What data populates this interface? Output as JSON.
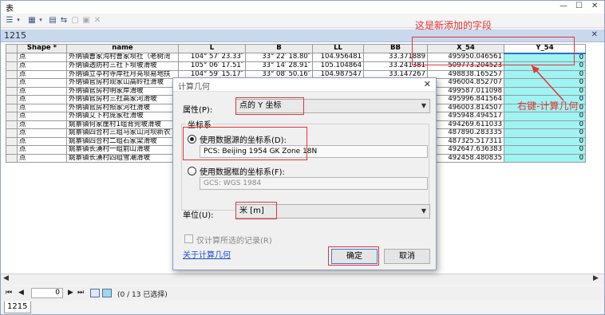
{
  "window": {
    "title": "表",
    "controls": {
      "minimize": "—",
      "restore": "☐",
      "close": "✕"
    }
  },
  "toolbar": {
    "icons": [
      "table-options-icon",
      "related-tables-icon",
      "select-by-attributes-icon",
      "switch-selection-icon",
      "clear-selection-icon",
      "zoom-to-selected-icon",
      "delete-selected-icon"
    ]
  },
  "tab": {
    "label": "1215",
    "close": "✕"
  },
  "table": {
    "headers": [
      "",
      "Shape *",
      "name",
      "L",
      "B",
      "LL",
      "BB",
      "X_54",
      "Y_54"
    ],
    "rows": [
      [
        "",
        "点",
        "外纳镇曹家沟村曹家坝社（老树湾",
        "104° 57′ 23.33″",
        "33° 22′ 18.80″",
        "104.956481",
        "33.371889",
        "495950.046561",
        "0"
      ],
      [
        "",
        "点",
        "外纳镇透防村三社下坝坡滑坡",
        "105° 06′ 17.51″",
        "33° 14′ 28.91″",
        "105.104864",
        "33.241381",
        "509773.204523",
        "0"
      ],
      [
        "",
        "点",
        "外纳镇立亭村寺岸社月亮坝易地扶",
        "104° 59′ 15.17″",
        "33° 08′ 50.16″",
        "104.987547",
        "33.147267",
        "498838.165257",
        "0"
      ],
      [
        "",
        "点",
        "外纳镇官房村现家山高岭社滑坡",
        "",
        "",
        "",
        "",
        "496004.852707",
        "0"
      ],
      [
        "",
        "点",
        "外纳镇官房村明家岸滑坡",
        "",
        "",
        "",
        "",
        "499587.011098",
        "0"
      ],
      [
        "",
        "点",
        "外纳镇官房村三社高家河滑坡",
        "",
        "",
        "",
        "",
        "495996.841564",
        "0"
      ],
      [
        "",
        "点",
        "外纳镇官房村照家河社滑坡",
        "",
        "",
        "",
        "",
        "496003.814507",
        "0"
      ],
      [
        "",
        "点",
        "外纳镇艾下村庞家社滑坡",
        "",
        "",
        "",
        "",
        "495948.494517",
        "0"
      ],
      [
        "",
        "点",
        "姚寨镇何家崖村1组背兜坡滑坡",
        "",
        "",
        "",
        "",
        "494269.611033",
        "0"
      ],
      [
        "",
        "点",
        "姚寨镇四合村三组马家山河坝新农",
        "",
        "",
        "",
        "",
        "487890.283335",
        "0"
      ],
      [
        "",
        "点",
        "姚寨镇四合村二组石家梁滑坡",
        "",
        "",
        "",
        "",
        "487325.517311",
        "0"
      ],
      [
        "",
        "点",
        "姚寨镇长湧村一组前山滑坡",
        "",
        "",
        "",
        "",
        "492647.636383",
        "0"
      ],
      [
        "",
        "点",
        "姚寨镇长湧村四组雪潮滑坡",
        "",
        "",
        "",
        "",
        "492458.480835",
        "0"
      ]
    ]
  },
  "navigation": {
    "first": "⏮",
    "prev": "◀",
    "current": "0",
    "next": "▶",
    "last": "⏭",
    "status": "(0 / 13 已选择)"
  },
  "status_tab": "1215",
  "annotations": {
    "new_field": "这是新添加的字段",
    "right_click": "右键-计算几何"
  },
  "dialog": {
    "title": "计算几何",
    "close": "✕",
    "property_label": "属性(P):",
    "property_value": "点的 Y 坐标",
    "coord_group": "坐标系",
    "use_source_label": "使用数据源的坐标系(D):",
    "source_cs": "PCS: Beijing 1954 GK Zone 18N",
    "use_frame_label": "使用数据框的坐标系(F):",
    "frame_cs": "GCS: WGS 1984",
    "unit_label": "单位(U):",
    "unit_value": "米 [m]",
    "selected_only_label": "仅计算所选的记录(R)",
    "help_link": "关于计算几何",
    "ok": "确定",
    "cancel": "取消"
  },
  "colors": {
    "annotation": "#e53434",
    "selected_column": "#9ff3f3",
    "link": "#1a4fd0"
  }
}
